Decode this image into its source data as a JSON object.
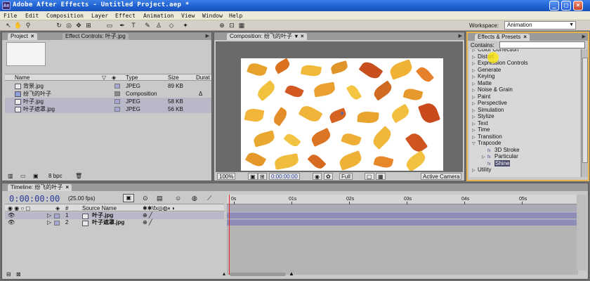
{
  "window": {
    "title": "Adobe After Effects - Untitled Project.aep *",
    "minimize": "_",
    "maximize": "□",
    "close": "×"
  },
  "menu": [
    "File",
    "Edit",
    "Composition",
    "Layer",
    "Effect",
    "Animation",
    "View",
    "Window",
    "Help"
  ],
  "workspace": {
    "label": "Workspace:",
    "value": "Animation"
  },
  "project": {
    "tab": "Project",
    "tab2": "Effect Controls: 叶子.jpg",
    "columns": {
      "name": "Name",
      "type": "Type",
      "size": "Size",
      "duration": "Durat"
    },
    "items": [
      {
        "name": "背景.jpg",
        "type": "JPEG",
        "size": "89 KB",
        "duration": "",
        "kind": "jpeg"
      },
      {
        "name": "纷飞的叶子",
        "type": "Composition",
        "size": "",
        "duration": "Δ",
        "kind": "comp"
      },
      {
        "name": "叶子.jpg",
        "type": "JPEG",
        "size": "58 KB",
        "duration": "",
        "kind": "jpeg"
      },
      {
        "name": "叶子遮罩.jpg",
        "type": "JPEG",
        "size": "56 KB",
        "duration": "",
        "kind": "jpeg"
      }
    ],
    "bpc": "8 bpc"
  },
  "composition": {
    "tab": "Composition: 纷飞的叶子",
    "zoom": "100%",
    "timecode": "0:00:00:00",
    "resolution": "Full",
    "camera": "Active Camera"
  },
  "effects": {
    "tab": "Effects & Presets",
    "contains_label": "Contains:",
    "items": [
      {
        "name": "Color Correction",
        "level": 0
      },
      {
        "name": "Distort",
        "level": 0
      },
      {
        "name": "Expression Controls",
        "level": 0
      },
      {
        "name": "Generate",
        "level": 0
      },
      {
        "name": "Keying",
        "level": 0
      },
      {
        "name": "Matte",
        "level": 0
      },
      {
        "name": "Noise & Grain",
        "level": 0
      },
      {
        "name": "Paint",
        "level": 0
      },
      {
        "name": "Perspective",
        "level": 0
      },
      {
        "name": "Simulation",
        "level": 0
      },
      {
        "name": "Stylize",
        "level": 0
      },
      {
        "name": "Text",
        "level": 0
      },
      {
        "name": "Time",
        "level": 0
      },
      {
        "name": "Transition",
        "level": 0
      },
      {
        "name": "Trapcode",
        "level": 0,
        "open": true
      },
      {
        "name": "3D Stroke",
        "level": 2
      },
      {
        "name": "Particular",
        "level": 1
      },
      {
        "name": "Shine",
        "level": 2,
        "selected": true
      },
      {
        "name": "Utility",
        "level": 0
      }
    ]
  },
  "timeline": {
    "tab": "Timeline: 纷飞的叶子",
    "timecode": "0:00:00:00",
    "fps": "(25.00 fps)",
    "source_name_header": "Source Name",
    "ruler": [
      "0s",
      "01s",
      "02s",
      "03s",
      "04s",
      "05s"
    ],
    "layers": [
      {
        "num": "1",
        "name": "叶子.jpg"
      },
      {
        "num": "2",
        "name": "叶子遮罩.jpg"
      }
    ]
  },
  "colors": {
    "accent": "#e8b24c",
    "timecode": "#2a3a9a",
    "playhead": "#ee2222",
    "layer_bar": "#8d8db8"
  }
}
